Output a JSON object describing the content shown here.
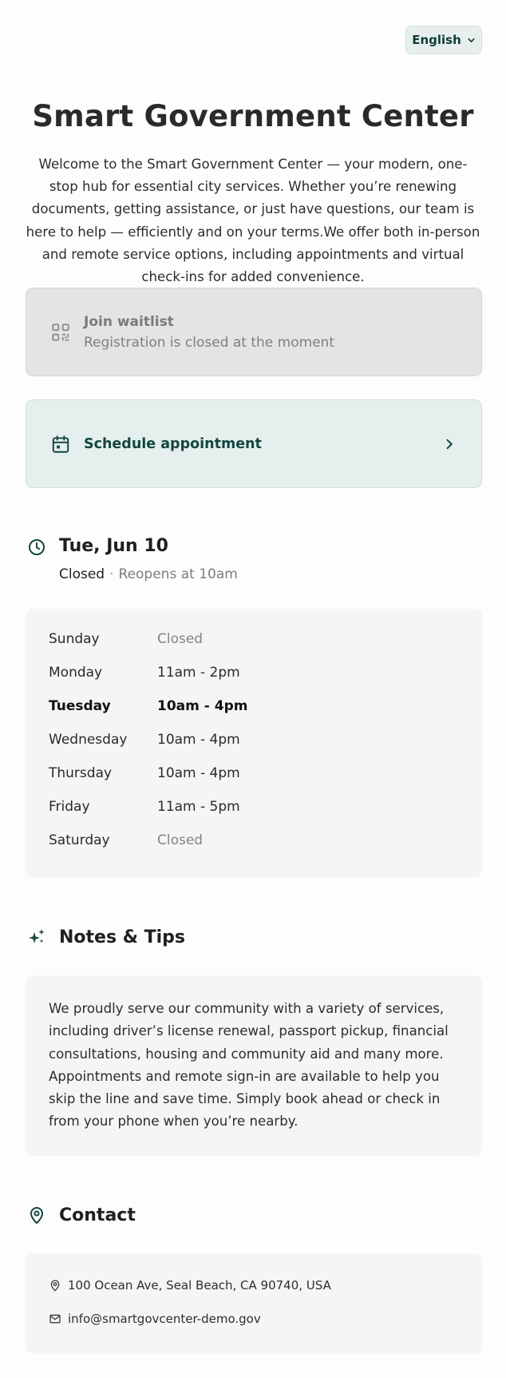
{
  "language": {
    "label": "English"
  },
  "header": {
    "title": "Smart Government Center",
    "intro": "Welcome to the Smart Government Center — your modern, one-stop hub for essential city services. Whether you’re renewing documents, getting assistance, or just have questions, our team is here to help — efficiently and on your terms.We offer both in-person and remote service options, including appointments and virtual check-ins for added convenience."
  },
  "waitlist": {
    "title": "Join waitlist",
    "subtitle": "Registration is closed at the moment",
    "icon": "qr-code-icon"
  },
  "schedule": {
    "label": "Schedule appointment",
    "icon": "calendar-icon"
  },
  "today": {
    "date": "Tue, Jun 10",
    "status": "Closed",
    "separator": "·",
    "reopen": "Reopens at 10am"
  },
  "hours": [
    {
      "day": "Sunday",
      "time": "Closed",
      "closed": true,
      "today": false
    },
    {
      "day": "Monday",
      "time": "11am - 2pm",
      "closed": false,
      "today": false
    },
    {
      "day": "Tuesday",
      "time": "10am - 4pm",
      "closed": false,
      "today": true
    },
    {
      "day": "Wednesday",
      "time": "10am - 4pm",
      "closed": false,
      "today": false
    },
    {
      "day": "Thursday",
      "time": "10am - 4pm",
      "closed": false,
      "today": false
    },
    {
      "day": "Friday",
      "time": "11am - 5pm",
      "closed": false,
      "today": false
    },
    {
      "day": "Saturday",
      "time": "Closed",
      "closed": true,
      "today": false
    }
  ],
  "notes": {
    "title": "Notes & Tips",
    "text": "We proudly serve our community with a variety of services, including driver’s license renewal, passport pickup, financial consultations, housing and community aid and many more. Appointments and remote sign-in are available to help you skip the line and save time. Simply book ahead or check in from your phone when you’re nearby."
  },
  "contact": {
    "title": "Contact",
    "address": "100 Ocean Ave, Seal Beach, CA 90740, USA",
    "email": "info@smartgovcenter-demo.gov"
  },
  "colors": {
    "accent": "#134740",
    "schedule_bg": "#e5efee",
    "waitlist_bg": "#e4e4e3",
    "panel_bg": "#f5f5f5"
  }
}
